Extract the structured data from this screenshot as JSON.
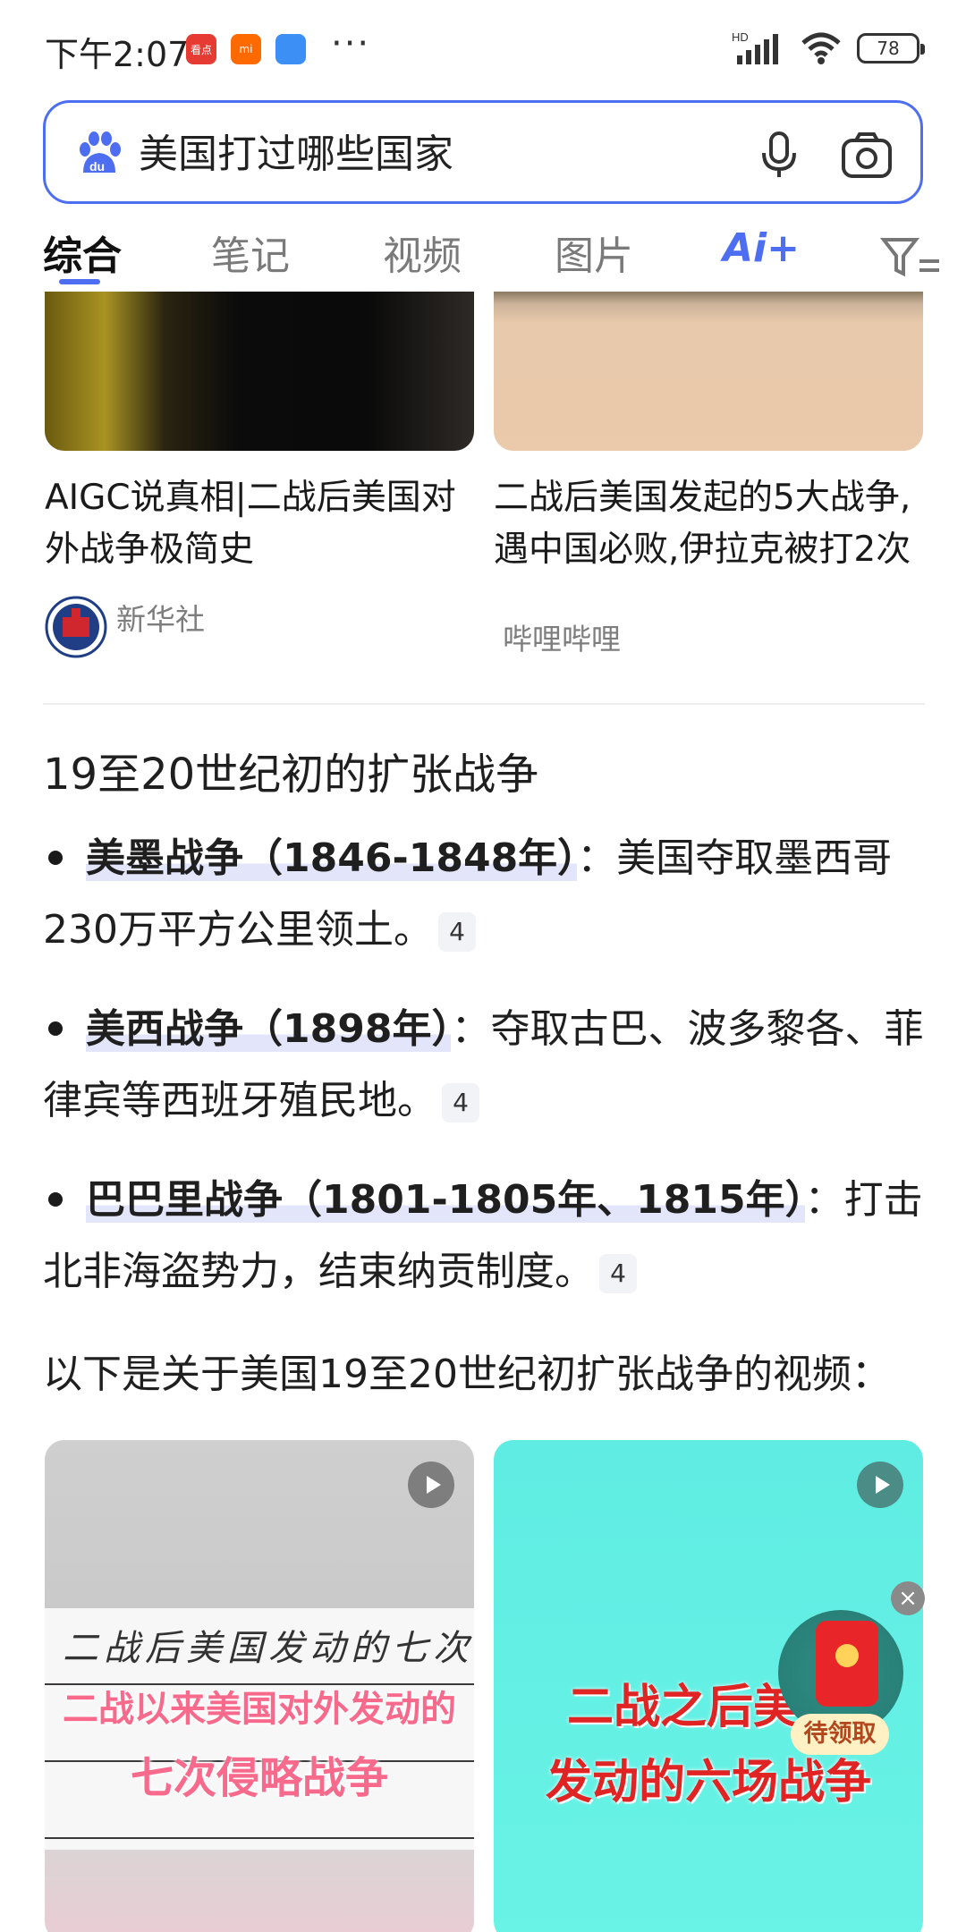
{
  "status_bar": {
    "time": "下午2:07",
    "dots": "···",
    "hd": "HD",
    "battery": "78",
    "app_icons": [
      "看点",
      "mi",
      "card"
    ]
  },
  "search": {
    "query": "美国打过哪些国家",
    "logo_text": "du"
  },
  "tabs": {
    "items": [
      "综合",
      "笔记",
      "视频",
      "图片"
    ],
    "ai_label": "Ai+",
    "active": "综合"
  },
  "top_cards": [
    {
      "title": "AIGC说真相|二战后美国对外战争极简史",
      "source": "新华社"
    },
    {
      "title": "二战后美国发起的5大战争,遇中国必败,伊拉克被打2次",
      "source": "哔哩哔哩"
    }
  ],
  "section": {
    "title": "19至20世纪初的扩张战争",
    "bullets": [
      {
        "head": "美墨战争（1846-1848年）",
        "text": "：美国夺取墨西哥230万平方公里领土。",
        "cite": "4"
      },
      {
        "head": "美西战争（1898年）",
        "text": "：夺取古巴、波多黎各、菲律宾等西班牙殖民地。",
        "cite": "4"
      },
      {
        "head": "巴巴里战争（1801-1805年、1815年）",
        "text": "：打击北非海盗势力，结束纳贡制度。",
        "cite": "4"
      }
    ],
    "intro": "以下是关于美国19至20世纪初扩张战争的视频："
  },
  "videos": [
    {
      "handwriting": "二战后美国发动的七次",
      "title_line1": "二战以来美国对外发动的",
      "title_line2": "七次侵略战争"
    },
    {
      "title_line1": "二战之后美",
      "title_line2": "发动的六场战争"
    }
  ],
  "float": {
    "close": "×",
    "label": "待领取"
  },
  "colors": {
    "accent": "#4e6ef2",
    "highlight": "#e3e6fa"
  }
}
